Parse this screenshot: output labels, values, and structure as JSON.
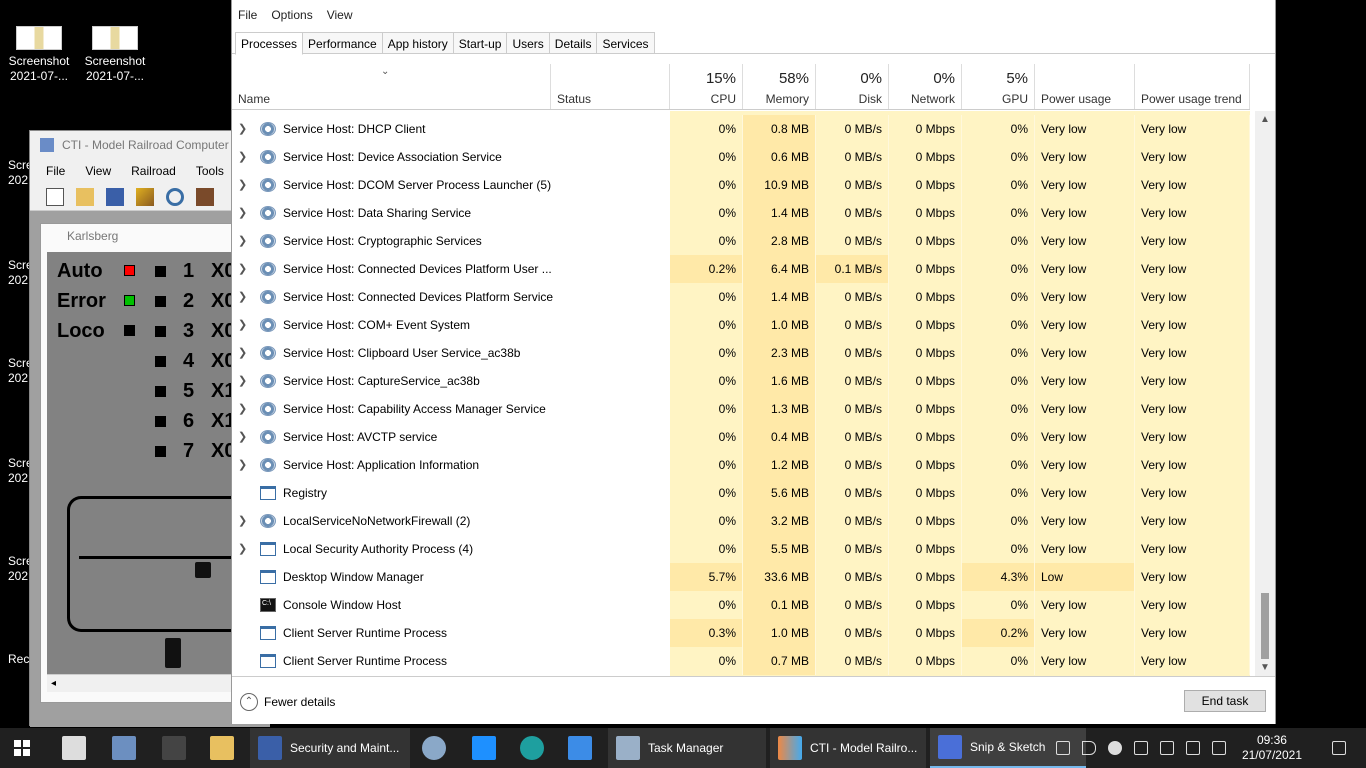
{
  "desktop": {
    "icons": [
      {
        "label1": "Screenshot",
        "label2": "2021-07-..."
      },
      {
        "label1": "Screenshot",
        "label2": "2021-07-..."
      }
    ],
    "partial_labels": [
      "Scre",
      "202",
      "Scre",
      "202",
      "Scre",
      "202",
      "Scre",
      "202",
      "Scre",
      "202",
      "Recy"
    ]
  },
  "cti": {
    "title": "CTI - Model Railroad Computer",
    "menu": [
      "File",
      "View",
      "Railroad",
      "Tools"
    ],
    "karlsberg": {
      "title": "Karlsberg",
      "rows": [
        {
          "label": "Auto",
          "color": "#ff0000"
        },
        {
          "label": "Error",
          "color": "#00c000"
        },
        {
          "label": "Loco",
          "color": "#000000"
        }
      ],
      "numbers": [
        "1",
        "2",
        "3",
        "4",
        "5",
        "6",
        "7"
      ],
      "codes": [
        "X0",
        "X0",
        "X0",
        "X0",
        "X1",
        "X1",
        "X0"
      ]
    }
  },
  "taskmanager": {
    "menu": [
      "File",
      "Options",
      "View"
    ],
    "tabs": [
      "Processes",
      "Performance",
      "App history",
      "Start-up",
      "Users",
      "Details",
      "Services"
    ],
    "active_tab": "Processes",
    "headers": {
      "name": "Name",
      "status": "Status",
      "cpu": {
        "pct": "15%",
        "label": "CPU"
      },
      "memory": {
        "pct": "58%",
        "label": "Memory"
      },
      "disk": {
        "pct": "0%",
        "label": "Disk"
      },
      "network": {
        "pct": "0%",
        "label": "Network"
      },
      "gpu": {
        "pct": "5%",
        "label": "GPU"
      },
      "power": "Power usage",
      "power_trend": "Power usage trend"
    },
    "rows": [
      {
        "name": "Service Host: DHCP Client",
        "icon": "gear",
        "expand": true,
        "cpu": "0%",
        "mem": "0.8 MB",
        "disk": "0 MB/s",
        "net": "0 Mbps",
        "gpu": "0%",
        "power": "Very low",
        "trend": "Very low"
      },
      {
        "name": "Service Host: Device Association Service",
        "icon": "gear",
        "expand": true,
        "cpu": "0%",
        "mem": "0.6 MB",
        "disk": "0 MB/s",
        "net": "0 Mbps",
        "gpu": "0%",
        "power": "Very low",
        "trend": "Very low"
      },
      {
        "name": "Service Host: DCOM Server Process Launcher (5)",
        "icon": "gear",
        "expand": true,
        "cpu": "0%",
        "mem": "10.9 MB",
        "disk": "0 MB/s",
        "net": "0 Mbps",
        "gpu": "0%",
        "power": "Very low",
        "trend": "Very low"
      },
      {
        "name": "Service Host: Data Sharing Service",
        "icon": "gear",
        "expand": true,
        "cpu": "0%",
        "mem": "1.4 MB",
        "disk": "0 MB/s",
        "net": "0 Mbps",
        "gpu": "0%",
        "power": "Very low",
        "trend": "Very low"
      },
      {
        "name": "Service Host: Cryptographic Services",
        "icon": "gear",
        "expand": true,
        "cpu": "0%",
        "mem": "2.8 MB",
        "disk": "0 MB/s",
        "net": "0 Mbps",
        "gpu": "0%",
        "power": "Very low",
        "trend": "Very low"
      },
      {
        "name": "Service Host: Connected Devices Platform User ...",
        "icon": "gear",
        "expand": true,
        "cpu": "0.2%",
        "mem": "6.4 MB",
        "disk": "0.1 MB/s",
        "net": "0 Mbps",
        "gpu": "0%",
        "power": "Very low",
        "trend": "Very low"
      },
      {
        "name": "Service Host: Connected Devices Platform Service",
        "icon": "gear",
        "expand": true,
        "cpu": "0%",
        "mem": "1.4 MB",
        "disk": "0 MB/s",
        "net": "0 Mbps",
        "gpu": "0%",
        "power": "Very low",
        "trend": "Very low"
      },
      {
        "name": "Service Host: COM+ Event System",
        "icon": "gear",
        "expand": true,
        "cpu": "0%",
        "mem": "1.0 MB",
        "disk": "0 MB/s",
        "net": "0 Mbps",
        "gpu": "0%",
        "power": "Very low",
        "trend": "Very low"
      },
      {
        "name": "Service Host: Clipboard User Service_ac38b",
        "icon": "gear",
        "expand": true,
        "cpu": "0%",
        "mem": "2.3 MB",
        "disk": "0 MB/s",
        "net": "0 Mbps",
        "gpu": "0%",
        "power": "Very low",
        "trend": "Very low"
      },
      {
        "name": "Service Host: CaptureService_ac38b",
        "icon": "gear",
        "expand": true,
        "cpu": "0%",
        "mem": "1.6 MB",
        "disk": "0 MB/s",
        "net": "0 Mbps",
        "gpu": "0%",
        "power": "Very low",
        "trend": "Very low"
      },
      {
        "name": "Service Host: Capability Access Manager Service",
        "icon": "gear",
        "expand": true,
        "cpu": "0%",
        "mem": "1.3 MB",
        "disk": "0 MB/s",
        "net": "0 Mbps",
        "gpu": "0%",
        "power": "Very low",
        "trend": "Very low"
      },
      {
        "name": "Service Host: AVCTP service",
        "icon": "gear",
        "expand": true,
        "cpu": "0%",
        "mem": "0.4 MB",
        "disk": "0 MB/s",
        "net": "0 Mbps",
        "gpu": "0%",
        "power": "Very low",
        "trend": "Very low"
      },
      {
        "name": "Service Host: Application Information",
        "icon": "gear",
        "expand": true,
        "cpu": "0%",
        "mem": "1.2 MB",
        "disk": "0 MB/s",
        "net": "0 Mbps",
        "gpu": "0%",
        "power": "Very low",
        "trend": "Very low"
      },
      {
        "name": "Registry",
        "icon": "win",
        "expand": false,
        "cpu": "0%",
        "mem": "5.6 MB",
        "disk": "0 MB/s",
        "net": "0 Mbps",
        "gpu": "0%",
        "power": "Very low",
        "trend": "Very low"
      },
      {
        "name": "LocalServiceNoNetworkFirewall (2)",
        "icon": "gear",
        "expand": true,
        "cpu": "0%",
        "mem": "3.2 MB",
        "disk": "0 MB/s",
        "net": "0 Mbps",
        "gpu": "0%",
        "power": "Very low",
        "trend": "Very low"
      },
      {
        "name": "Local Security Authority Process (4)",
        "icon": "win",
        "expand": true,
        "cpu": "0%",
        "mem": "5.5 MB",
        "disk": "0 MB/s",
        "net": "0 Mbps",
        "gpu": "0%",
        "power": "Very low",
        "trend": "Very low"
      },
      {
        "name": "Desktop Window Manager",
        "icon": "win",
        "expand": false,
        "cpu": "5.7%",
        "mem": "33.6 MB",
        "disk": "0 MB/s",
        "net": "0 Mbps",
        "gpu": "4.3%",
        "power": "Low",
        "trend": "Very low"
      },
      {
        "name": "Console Window Host",
        "icon": "cmd",
        "expand": false,
        "cpu": "0%",
        "mem": "0.1 MB",
        "disk": "0 MB/s",
        "net": "0 Mbps",
        "gpu": "0%",
        "power": "Very low",
        "trend": "Very low"
      },
      {
        "name": "Client Server Runtime Process",
        "icon": "win",
        "expand": false,
        "cpu": "0.3%",
        "mem": "1.0 MB",
        "disk": "0 MB/s",
        "net": "0 Mbps",
        "gpu": "0.2%",
        "power": "Very low",
        "trend": "Very low"
      },
      {
        "name": "Client Server Runtime Process",
        "icon": "win",
        "expand": false,
        "cpu": "0%",
        "mem": "0.7 MB",
        "disk": "0 MB/s",
        "net": "0 Mbps",
        "gpu": "0%",
        "power": "Very low",
        "trend": "Very low"
      }
    ],
    "fewer_details": "Fewer details",
    "end_task": "End task",
    "colors": {
      "heat_low": "#fff4c4",
      "heat_mid": "#ffe9a8",
      "heat_high": "#f9ec8a"
    }
  },
  "taskbar": {
    "items": [
      {
        "label": "Security and Maint...",
        "icon": "flag-icon"
      },
      {
        "label": "Task Manager",
        "icon": "task-manager-icon"
      },
      {
        "label": "CTI - Model Railro...",
        "icon": "cti-icon"
      },
      {
        "label": "Snip & Sketch",
        "icon": "snip-icon"
      }
    ],
    "time": "09:36",
    "date": "21/07/2021"
  }
}
